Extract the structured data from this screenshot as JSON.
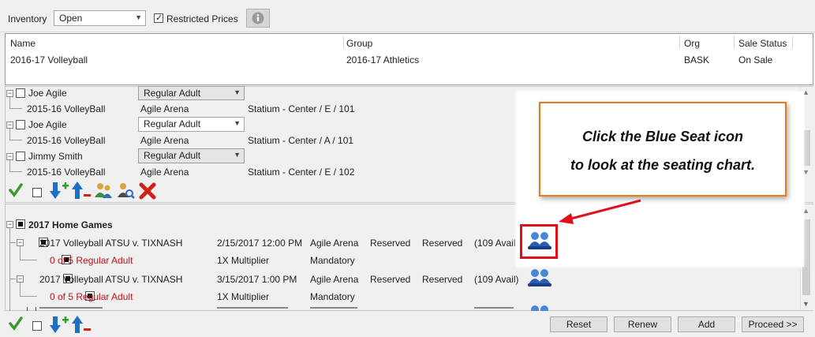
{
  "toolbar": {
    "inventory_label": "Inventory",
    "inventory_value": "Open",
    "restricted_label": "Restricted Prices"
  },
  "header": {
    "columns": [
      "Name",
      "Group",
      "Org",
      "Sale Status"
    ],
    "row": {
      "name": "2016-17 Volleyball",
      "group": "2016-17 Athletics",
      "org": "BASK",
      "status": "On Sale"
    }
  },
  "cart": {
    "entries": [
      {
        "name": "Joe Agile",
        "price_type": "Regular Adult",
        "event": "2015-16 VolleyBall",
        "venue": "Agile Arena",
        "seat": "Statium  - Center / E / 101"
      },
      {
        "name": "Joe Agile",
        "price_type": "Regular Adult",
        "event": "2015-16 VolleyBall",
        "venue": "Agile Arena",
        "seat": "Statium  - Center / A / 101"
      },
      {
        "name": "Jimmy  Smith",
        "price_type": "Regular Adult",
        "event": "2015-16 VolleyBall",
        "venue": "Agile Arena",
        "seat": "Statium  - Center / E / 102"
      }
    ]
  },
  "events": {
    "group_title": "2017 Home Games",
    "rows": [
      {
        "name": "2017 Volleyball ATSU v. TIXNASH",
        "date": "2/15/2017 12:00 PM",
        "venue": "Agile Arena",
        "type": "Reserved",
        "mode": "Reserved",
        "avail": "(109 Avail)",
        "sub": {
          "qty": "0 of 5 Regular Adult",
          "multiplier": "1X Multiplier",
          "req": "Mandatory"
        }
      },
      {
        "name": "2017 Volleyball ATSU v. TIXNASH",
        "date": "3/15/2017 1:00 PM",
        "venue": "Agile Arena",
        "type": "Reserved",
        "mode": "Reserved",
        "avail": "(109 Avail)",
        "sub": {
          "qty": "0 of 5 Regular Adult",
          "multiplier": "1X Multiplier",
          "req": "Mandatory"
        }
      }
    ]
  },
  "footer": {
    "reset": "Reset",
    "renew": "Renew",
    "add": "Add",
    "proceed": "Proceed >>"
  },
  "callout": {
    "line1": "Click the Blue Seat icon",
    "line2": "to look at the seating chart."
  },
  "colors": {
    "callout_border": "#e8791d",
    "highlight": "#e0101a",
    "seat_icon": "#2a5fb5",
    "qty_text": "#c0101a"
  }
}
